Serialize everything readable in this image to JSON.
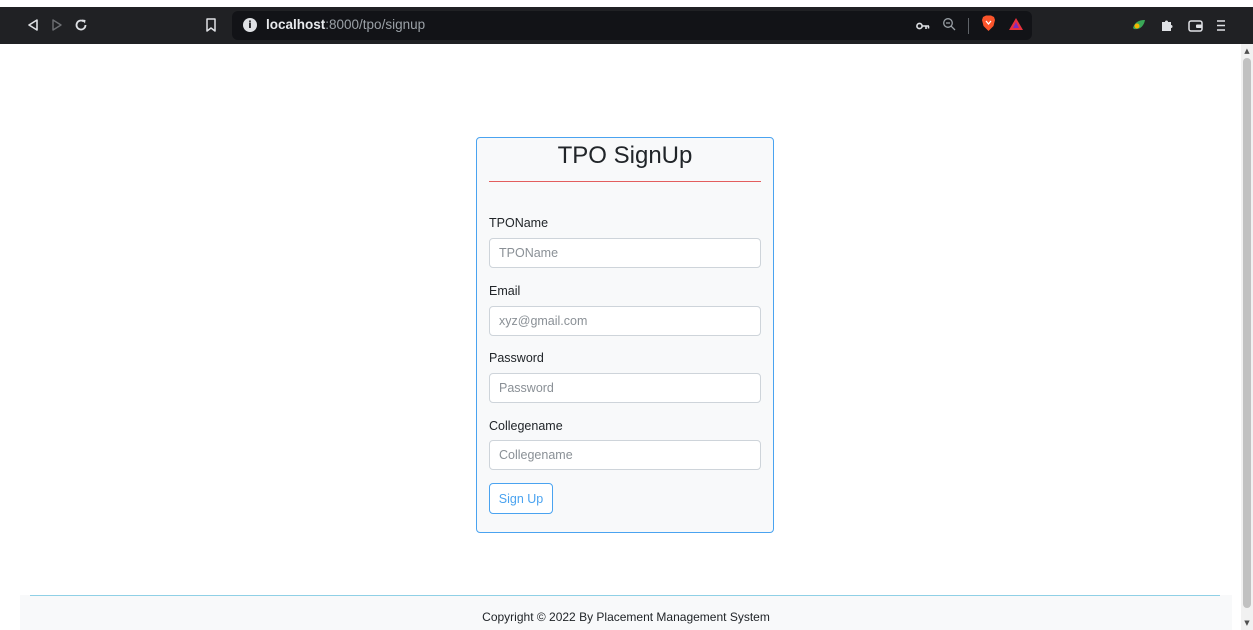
{
  "browser": {
    "url_host": "localhost",
    "url_path": ":8000/tpo/signup",
    "info_glyph": "i",
    "icons": [
      "back-icon",
      "forward-icon",
      "reload-icon",
      "bookmark-icon",
      "key-icon",
      "zoom-icon",
      "brave-shield-icon",
      "brave-rewards-icon",
      "extension-leaf-icon",
      "extensions-puzzle-icon",
      "wallet-icon",
      "menu-icon"
    ]
  },
  "form": {
    "title": "TPO SignUp",
    "fields": [
      {
        "label": "TPOName",
        "placeholder": "TPOName"
      },
      {
        "label": "Email",
        "placeholder": "xyz@gmail.com"
      },
      {
        "label": "Password",
        "placeholder": "Password"
      },
      {
        "label": "Collegename",
        "placeholder": "Collegename"
      }
    ],
    "submit_label": "Sign Up"
  },
  "footer": {
    "text": "Copyright © 2022 By Placement Management System"
  },
  "colors": {
    "accent": "#4aa3f0",
    "title_rule": "#e35d5d",
    "chrome_bg": "#202124"
  }
}
